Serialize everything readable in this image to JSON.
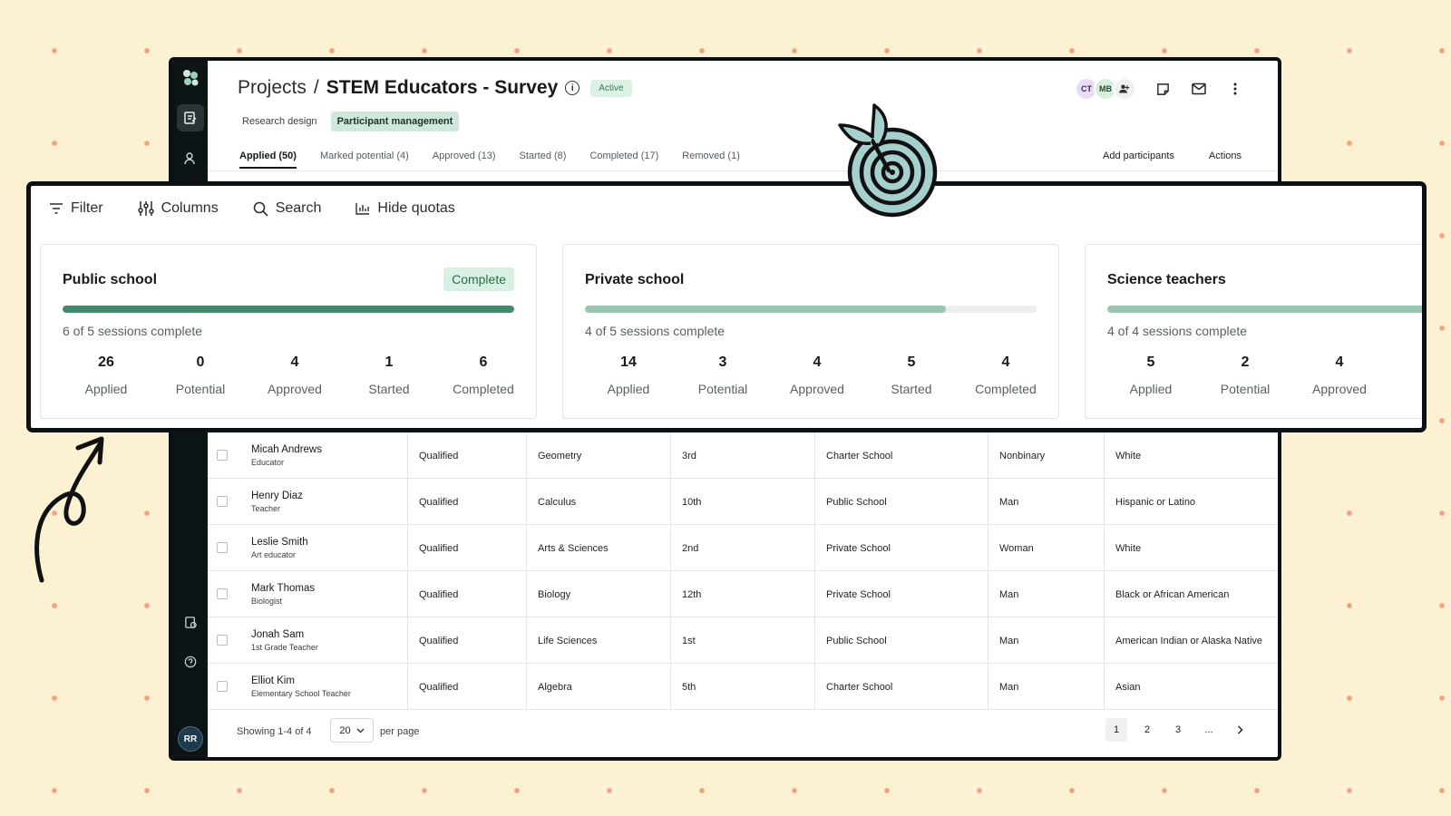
{
  "header": {
    "breadcrumb_parent": "Projects",
    "breadcrumb_sep": "/",
    "title": "STEM Educators - Survey",
    "info_icon": "i",
    "status": "Active",
    "avatars": [
      "CT",
      "MB"
    ]
  },
  "subtabs": [
    "Research design",
    "Participant management"
  ],
  "tabs": [
    "Applied (50)",
    "Marked potential (4)",
    "Approved (13)",
    "Started (8)",
    "Completed (17)",
    "Removed (1)"
  ],
  "tab_actions": [
    "Add participants",
    "Actions"
  ],
  "toolbar": [
    "Filter",
    "Columns",
    "Search",
    "Hide quotas"
  ],
  "quotas": [
    {
      "title": "Public school",
      "badge": "Complete",
      "progress": 1.0,
      "progress_color": "#3f8a6a",
      "subtitle": "6 of 5 sessions complete",
      "stats": [
        {
          "n": "26",
          "l": "Applied"
        },
        {
          "n": "0",
          "l": "Potential"
        },
        {
          "n": "4",
          "l": "Approved"
        },
        {
          "n": "1",
          "l": "Started"
        },
        {
          "n": "6",
          "l": "Completed"
        }
      ]
    },
    {
      "title": "Private school",
      "badge": "",
      "progress": 0.8,
      "progress_color": "#98c6ae",
      "subtitle": "4 of 5 sessions complete",
      "stats": [
        {
          "n": "14",
          "l": "Applied"
        },
        {
          "n": "3",
          "l": "Potential"
        },
        {
          "n": "4",
          "l": "Approved"
        },
        {
          "n": "5",
          "l": "Started"
        },
        {
          "n": "4",
          "l": "Completed"
        }
      ]
    },
    {
      "title": "Science teachers",
      "badge": "",
      "progress": 1.0,
      "progress_color": "#98c6ae",
      "subtitle": "4 of 4 sessions complete",
      "stats": [
        {
          "n": "5",
          "l": "Applied"
        },
        {
          "n": "2",
          "l": "Potential"
        },
        {
          "n": "4",
          "l": "Approved"
        }
      ]
    }
  ],
  "rows": [
    {
      "name": "Micah Andrews",
      "role": "Educator",
      "status": "Qualified",
      "subject": "Geometry",
      "grade": "3rd",
      "school": "Charter School",
      "gender": "Nonbinary",
      "ethnicity": "White"
    },
    {
      "name": "Henry Diaz",
      "role": "Teacher",
      "status": "Qualified",
      "subject": "Calculus",
      "grade": "10th",
      "school": "Public School",
      "gender": "Man",
      "ethnicity": "Hispanic or Latino"
    },
    {
      "name": "Leslie Smith",
      "role": "Art educator",
      "status": "Qualified",
      "subject": "Arts & Sciences",
      "grade": "2nd",
      "school": "Private School",
      "gender": "Woman",
      "ethnicity": "White"
    },
    {
      "name": "Mark Thomas",
      "role": "Biologist",
      "status": "Qualified",
      "subject": "Biology",
      "grade": "12th",
      "school": "Private School",
      "gender": "Man",
      "ethnicity": "Black or African American"
    },
    {
      "name": "Jonah Sam",
      "role": "1st Grade Teacher",
      "status": "Qualified",
      "subject": "Life Sciences",
      "grade": "1st",
      "school": "Public School",
      "gender": "Man",
      "ethnicity": "American Indian or Alaska Native"
    },
    {
      "name": "Elliot Kim",
      "role": "Elementary School Teacher",
      "status": "Qualified",
      "subject": "Algebra",
      "grade": "5th",
      "school": "Charter School",
      "gender": "Man",
      "ethnicity": "Asian"
    }
  ],
  "footer": {
    "showing": "Showing 1-4 of 4",
    "per_page_value": "20",
    "per_page_label": "per page",
    "pages": [
      "1",
      "2",
      "3",
      "..."
    ]
  },
  "user_avatar": "RR"
}
